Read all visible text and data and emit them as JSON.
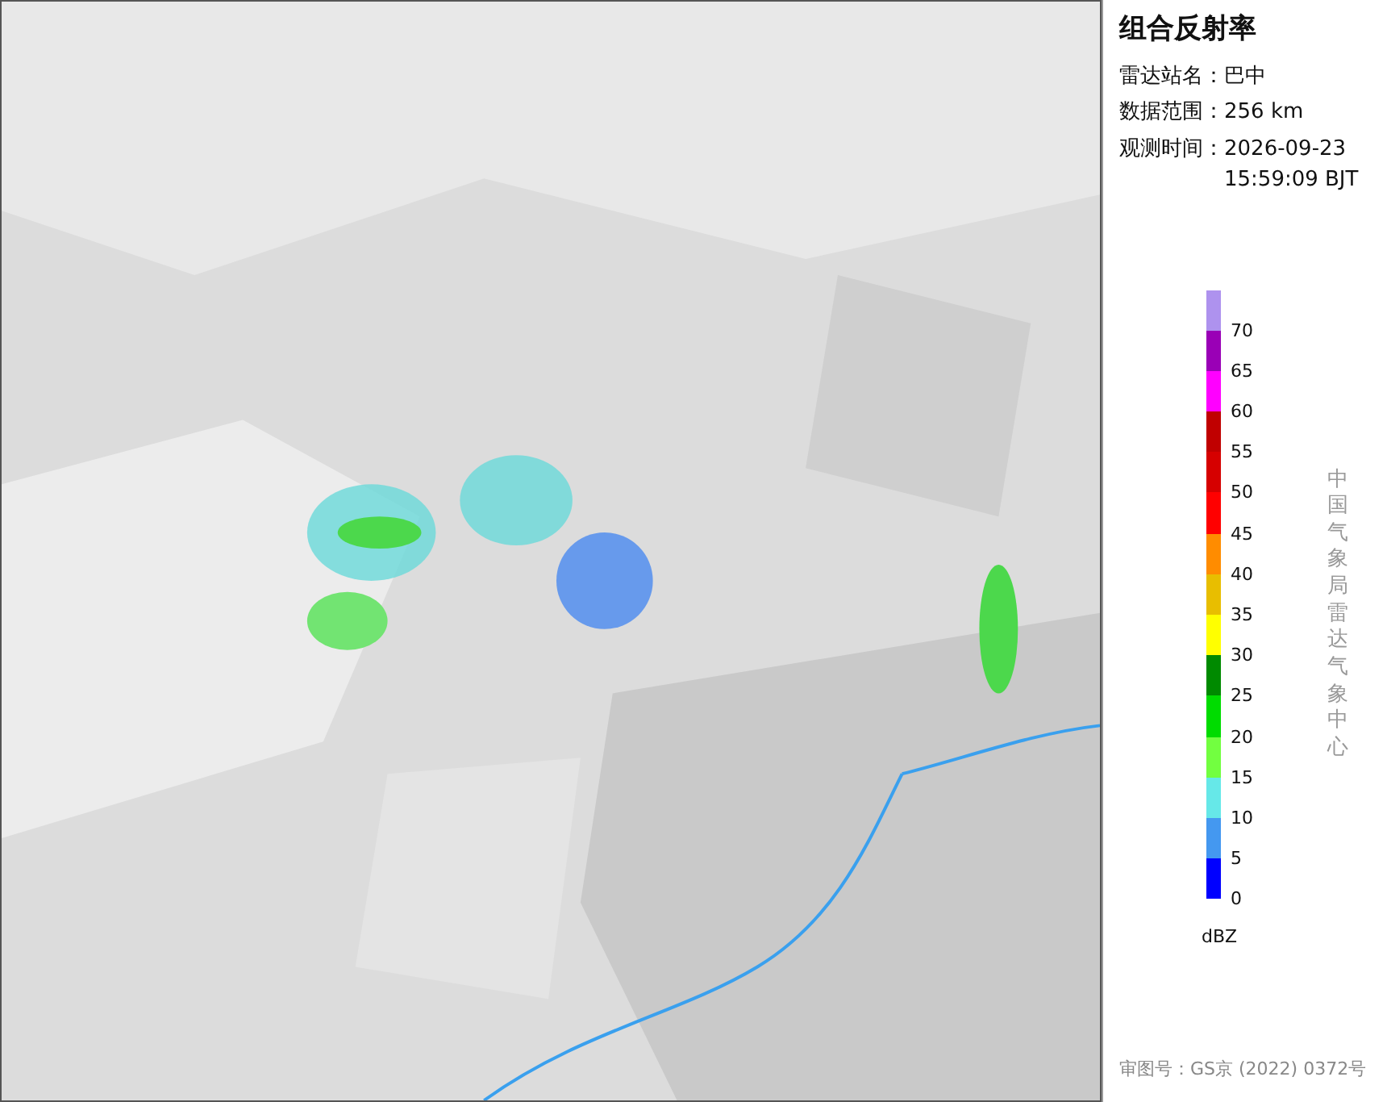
{
  "info_panel": {
    "title": "组合反射率",
    "fields": [
      {
        "label": "雷达站名：",
        "value": "巴中"
      },
      {
        "label": "数据范围：",
        "value": "256 km"
      },
      {
        "label": "观测时间：",
        "value": "2026-09-23",
        "value_line_2": "15:59:09 BJT"
      }
    ]
  },
  "legend": {
    "items": [
      {
        "color": "#ae92ee",
        "label": "70"
      },
      {
        "color": "#9a00b6",
        "label": "65"
      },
      {
        "color": "#ff00ff",
        "label": "60"
      },
      {
        "color": "#c00000",
        "label": "55"
      },
      {
        "color": "#d60000",
        "label": "50"
      },
      {
        "color": "#ff0000",
        "label": "45"
      },
      {
        "color": "#ff8c00",
        "label": "40"
      },
      {
        "color": "#e8be00",
        "label": "35"
      },
      {
        "color": "#ffff00",
        "label": "30"
      },
      {
        "color": "#008a00",
        "label": "25"
      },
      {
        "color": "#00dc00",
        "label": "20"
      },
      {
        "color": "#72ff40",
        "label": "15"
      },
      {
        "color": "#66e8e8",
        "label": "10"
      },
      {
        "color": "#4498f0",
        "label": "5"
      },
      {
        "color": "#0000ff",
        "label": "0"
      }
    ],
    "unit": "dBZ"
  },
  "credit": "中国气象局雷达气象中心",
  "approval_number": "审图号：GS京 (2022) 0372号"
}
